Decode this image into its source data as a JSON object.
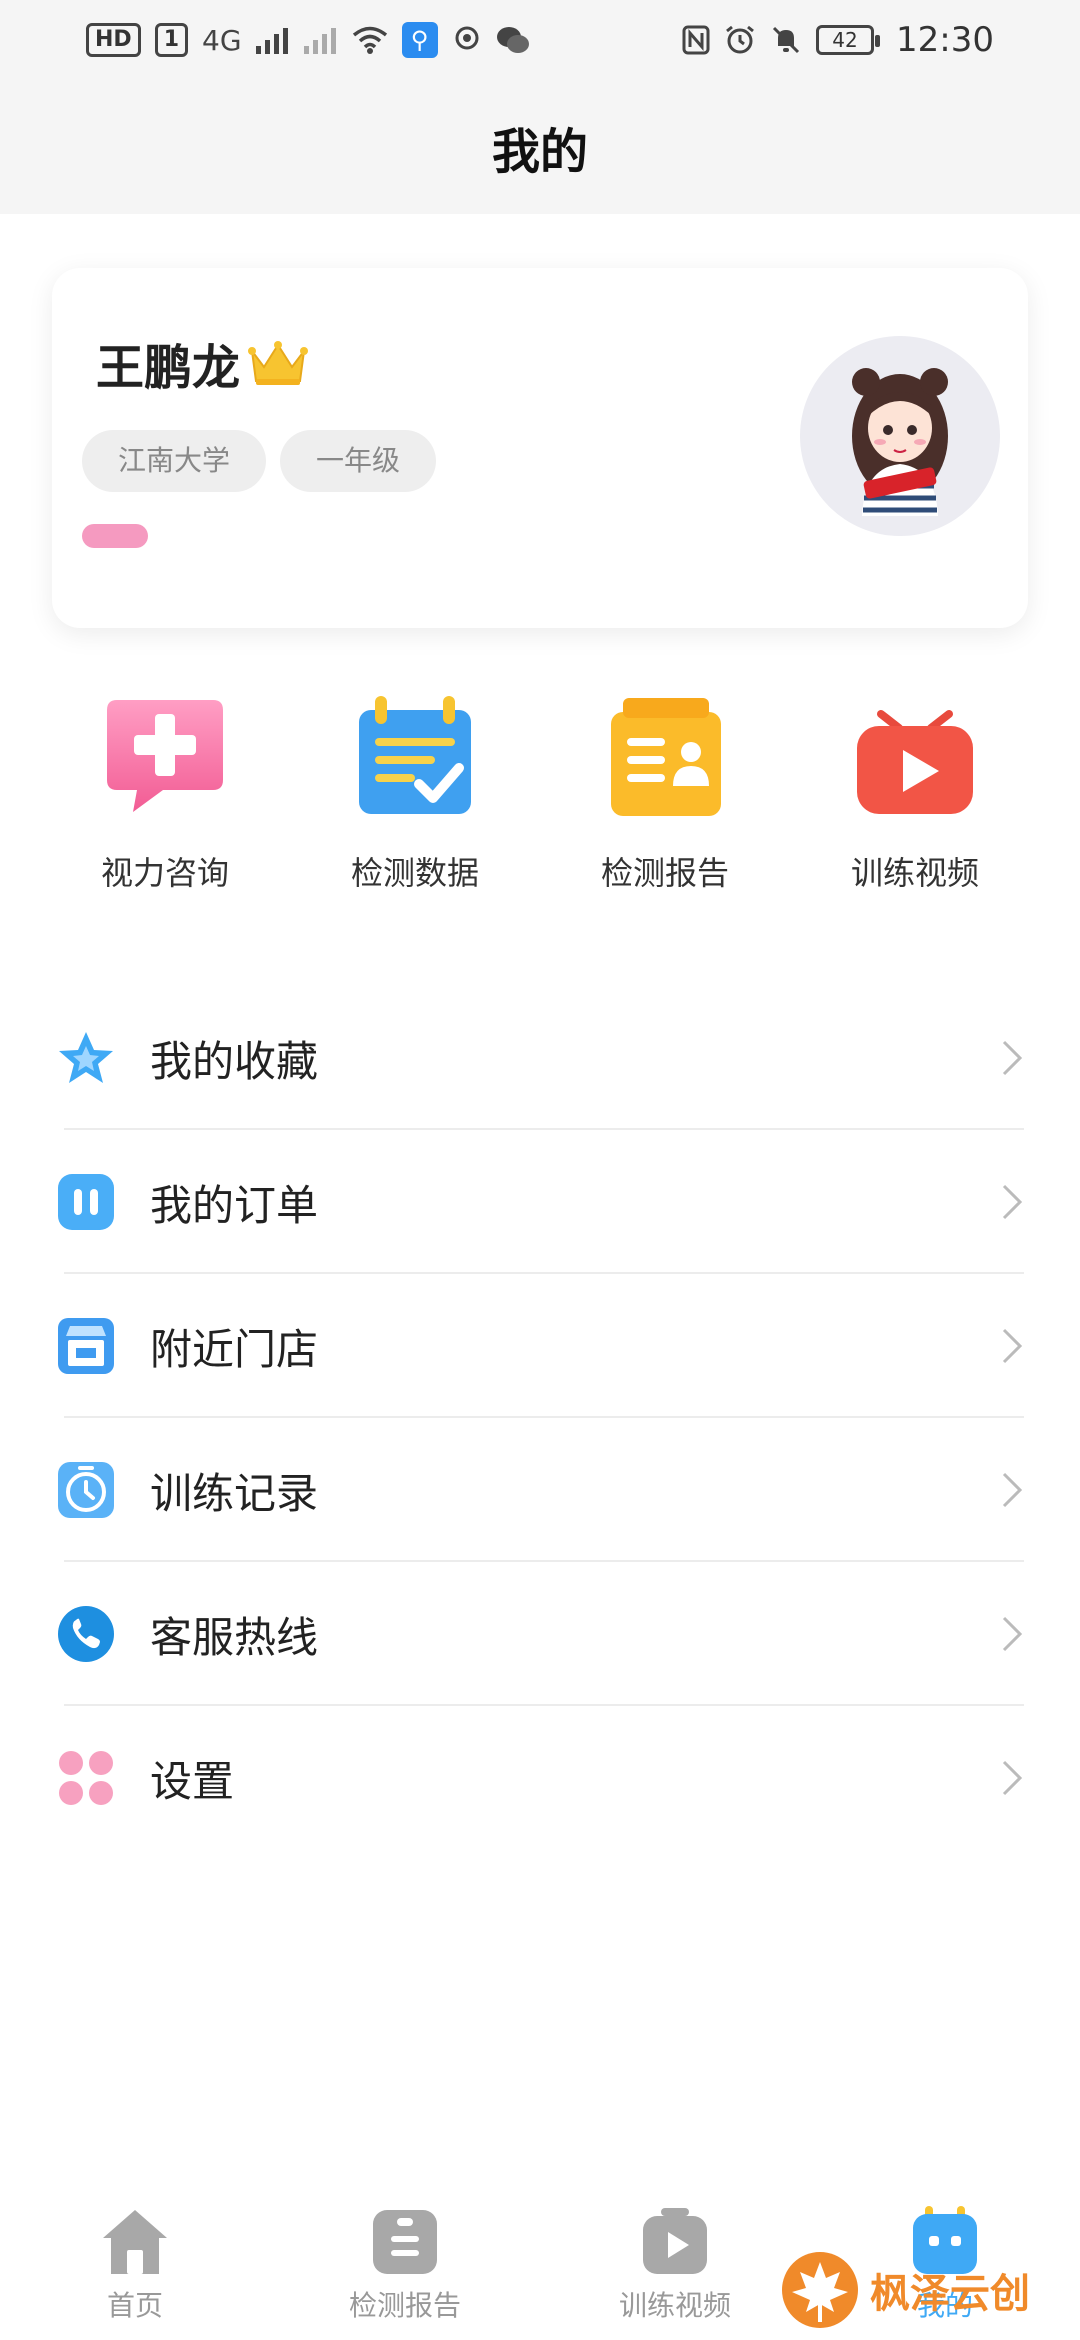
{
  "status_bar": {
    "left_badges": [
      "HD",
      "1",
      "4G"
    ],
    "time": "12:30",
    "battery": "42"
  },
  "header": {
    "title": "我的"
  },
  "profile": {
    "name": "王鹏龙",
    "tags": [
      "江南大学",
      "一年级"
    ]
  },
  "quick_actions": [
    {
      "label": "视力咨询",
      "icon": "consult-icon"
    },
    {
      "label": "检测数据",
      "icon": "data-icon"
    },
    {
      "label": "检测报告",
      "icon": "report-icon"
    },
    {
      "label": "训练视频",
      "icon": "video-icon"
    }
  ],
  "menu": [
    {
      "label": "我的收藏",
      "icon": "star-icon"
    },
    {
      "label": "我的订单",
      "icon": "order-icon"
    },
    {
      "label": "附近门店",
      "icon": "store-icon"
    },
    {
      "label": "训练记录",
      "icon": "clock-icon"
    },
    {
      "label": "客服热线",
      "icon": "phone-icon"
    },
    {
      "label": "设置",
      "icon": "settings-icon"
    }
  ],
  "bottom_nav": [
    {
      "label": "首页"
    },
    {
      "label": "检测报告"
    },
    {
      "label": "训练视频"
    },
    {
      "label": "我的",
      "active": true
    }
  ],
  "watermark": {
    "text": "枫泽云创"
  },
  "colors": {
    "accent": "#3fa9f5",
    "pink": "#f59ac0",
    "header_bg": "#f5f5f5"
  }
}
